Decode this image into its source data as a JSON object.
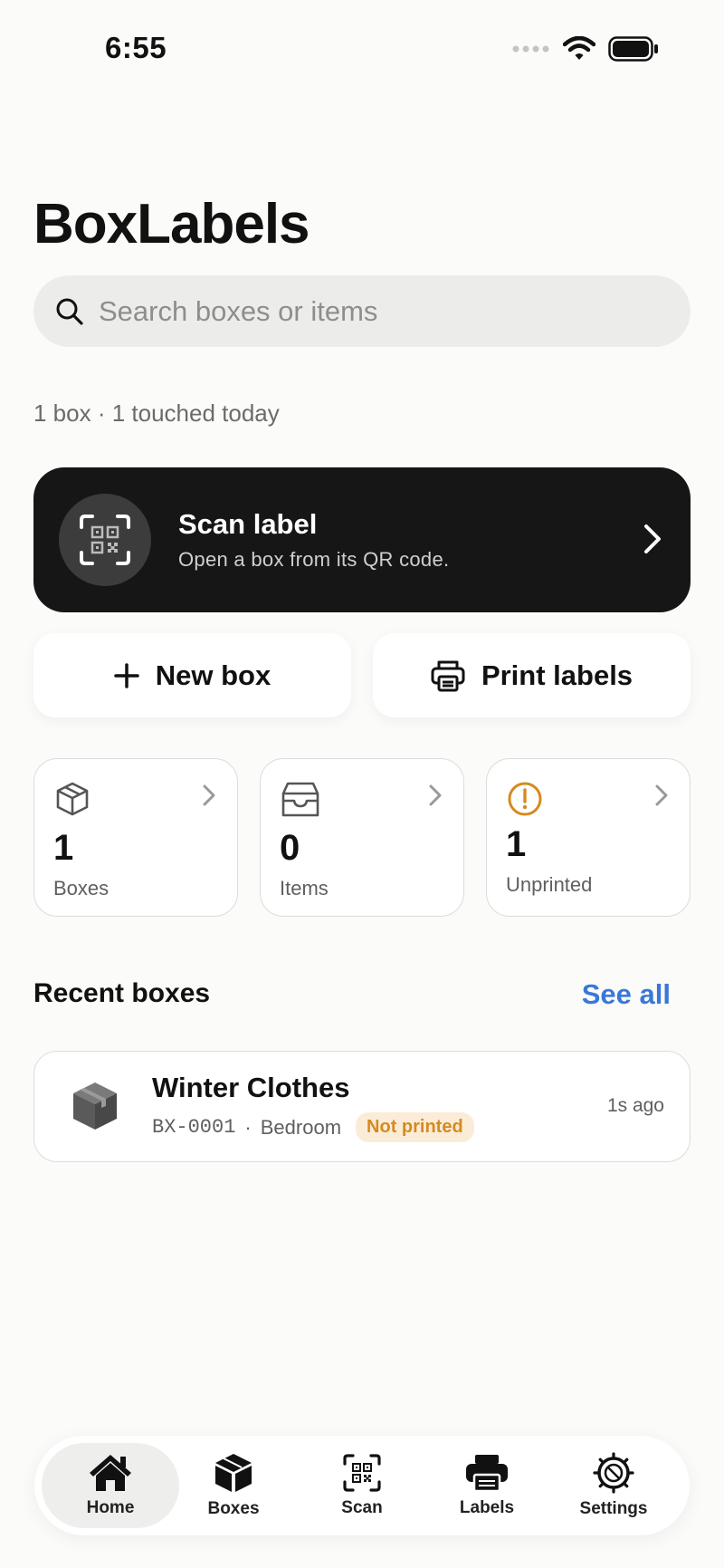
{
  "status_bar": {
    "time": "6:55",
    "icons": [
      "signal-icon",
      "wifi-icon",
      "battery-icon"
    ]
  },
  "app": {
    "title": "BoxLabels"
  },
  "search": {
    "placeholder": "Search boxes or items",
    "icon": "search-icon"
  },
  "summary": "1 box · 1 touched today",
  "scan_card": {
    "title": "Scan label",
    "subtitle": "Open a box from its QR code.",
    "icon": "qr-scan-icon"
  },
  "actions": {
    "new_box": "New box",
    "print_labels": "Print labels"
  },
  "stats": [
    {
      "value": "1",
      "label": "Boxes",
      "icon": "box-icon"
    },
    {
      "value": "0",
      "label": "Items",
      "icon": "tray-icon"
    },
    {
      "value": "1",
      "label": "Unprinted",
      "icon": "alert-icon",
      "accent": "#d68a1f"
    }
  ],
  "recent": {
    "title": "Recent boxes",
    "see_all": "See all",
    "items": [
      {
        "name": "Winter Clothes",
        "code": "BX-0001",
        "separator": "·",
        "location": "Bedroom",
        "badge": "Not printed",
        "time": "1s ago"
      }
    ]
  },
  "tabs": [
    {
      "label": "Home",
      "icon": "home-icon",
      "active": true
    },
    {
      "label": "Boxes",
      "icon": "box-icon",
      "active": false
    },
    {
      "label": "Scan",
      "icon": "qr-scan-icon",
      "active": false
    },
    {
      "label": "Labels",
      "icon": "printer-icon",
      "active": false
    },
    {
      "label": "Settings",
      "icon": "gear-icon",
      "active": false
    }
  ],
  "colors": {
    "accent_blue": "#3a78d8",
    "warning_orange": "#d68a1f",
    "badge_bg": "#fbecd8",
    "scan_card_bg": "#161616",
    "background": "#fbfbf9"
  }
}
